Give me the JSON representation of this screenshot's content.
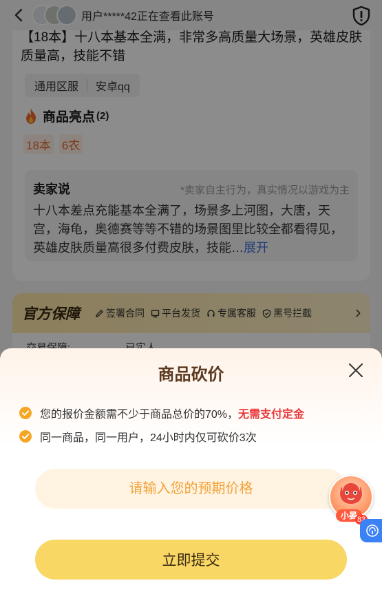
{
  "header": {
    "viewer_text": "用户*****42正在查看此账号"
  },
  "product": {
    "title": "【18本】十八本基本全满，非常多高质量大场景，英雄皮肤质量高，技能不错",
    "tags": [
      "通用区服",
      "安卓qq"
    ],
    "highlights_title": "商品亮点",
    "highlights_count": "(2)",
    "highlight_chips": [
      "18本",
      "6农"
    ]
  },
  "seller": {
    "title": "卖家说",
    "note": "*卖家自主行为，真实情况以游戏为主",
    "body": "十八本差点充能基本全满了，场景多上河图，大唐，天宫，海龟，奥德赛等等不错的场景图里比较全都看得见，英雄皮肤质量高很多付费皮肤，技能…",
    "expand_label": "展开"
  },
  "guarantee": {
    "title": "官方保障",
    "items": [
      "签署合同",
      "平台发货",
      "专属客服",
      "黑号拦截"
    ],
    "row_label": "交易保障:",
    "row_value": "已实人"
  },
  "sheet": {
    "title": "商品砍价",
    "rule1_text": "您的报价金额需不少于商品总价的70%，",
    "rule1_emph": "无需支付定金",
    "rule2_text": "同一商品，同一用户，24小时内仅可砍价3次",
    "input_placeholder": "请输入您的预期价格",
    "submit_label": "立即提交"
  },
  "assistant": {
    "label": "小晏",
    "badge": "83"
  },
  "colors": {
    "accent": "#f8d765",
    "check": "#f5a623",
    "emphasis": "#e83a3a",
    "link": "#3b6fd8"
  }
}
